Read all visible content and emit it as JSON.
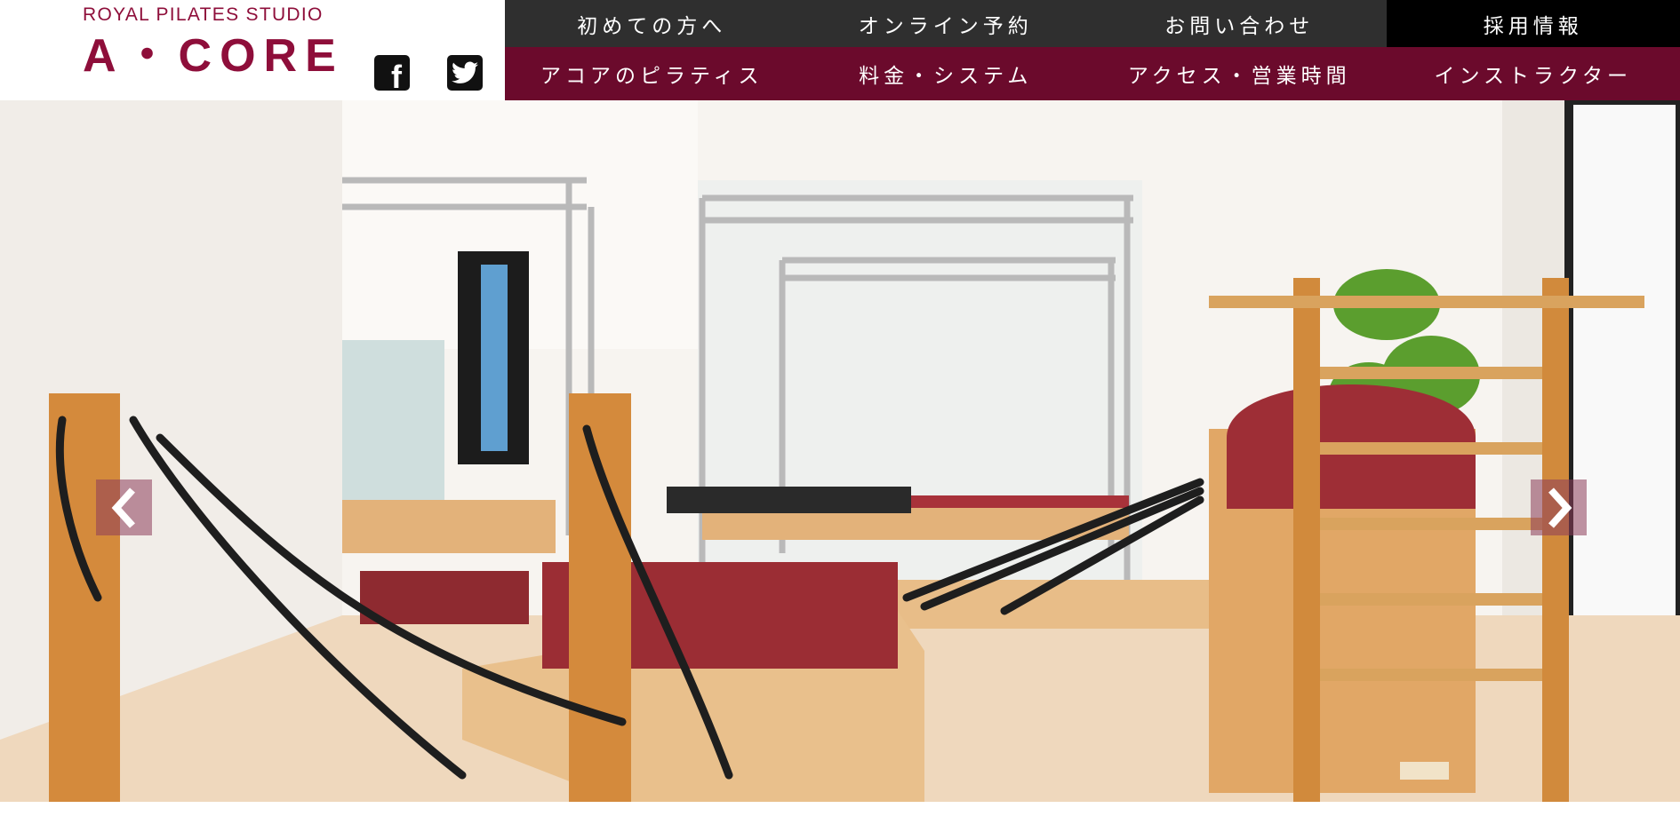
{
  "brand": {
    "tagline": "ROYAL PILATES STUDIO",
    "name": "A・CORE",
    "color": "#8e0e3a"
  },
  "social": [
    {
      "icon": "facebook-icon",
      "label": "f"
    },
    {
      "icon": "twitter-icon"
    }
  ],
  "nav": {
    "top": [
      {
        "label": "初めての方へ"
      },
      {
        "label": "オンライン予約"
      },
      {
        "label": "お問い合わせ"
      },
      {
        "label": "採用情報"
      }
    ],
    "bottom": [
      {
        "label": "アコアのピラティス"
      },
      {
        "label": "料金・システム"
      },
      {
        "label": "アクセス・営業時間"
      },
      {
        "label": "インストラクター"
      }
    ],
    "colors": {
      "top": "#2f2f2f",
      "bottom": "#6b0a2c",
      "highlight": "#000000"
    }
  },
  "hero": {
    "icons": {
      "prev": "chevron-left-icon",
      "next": "chevron-right-icon"
    }
  }
}
